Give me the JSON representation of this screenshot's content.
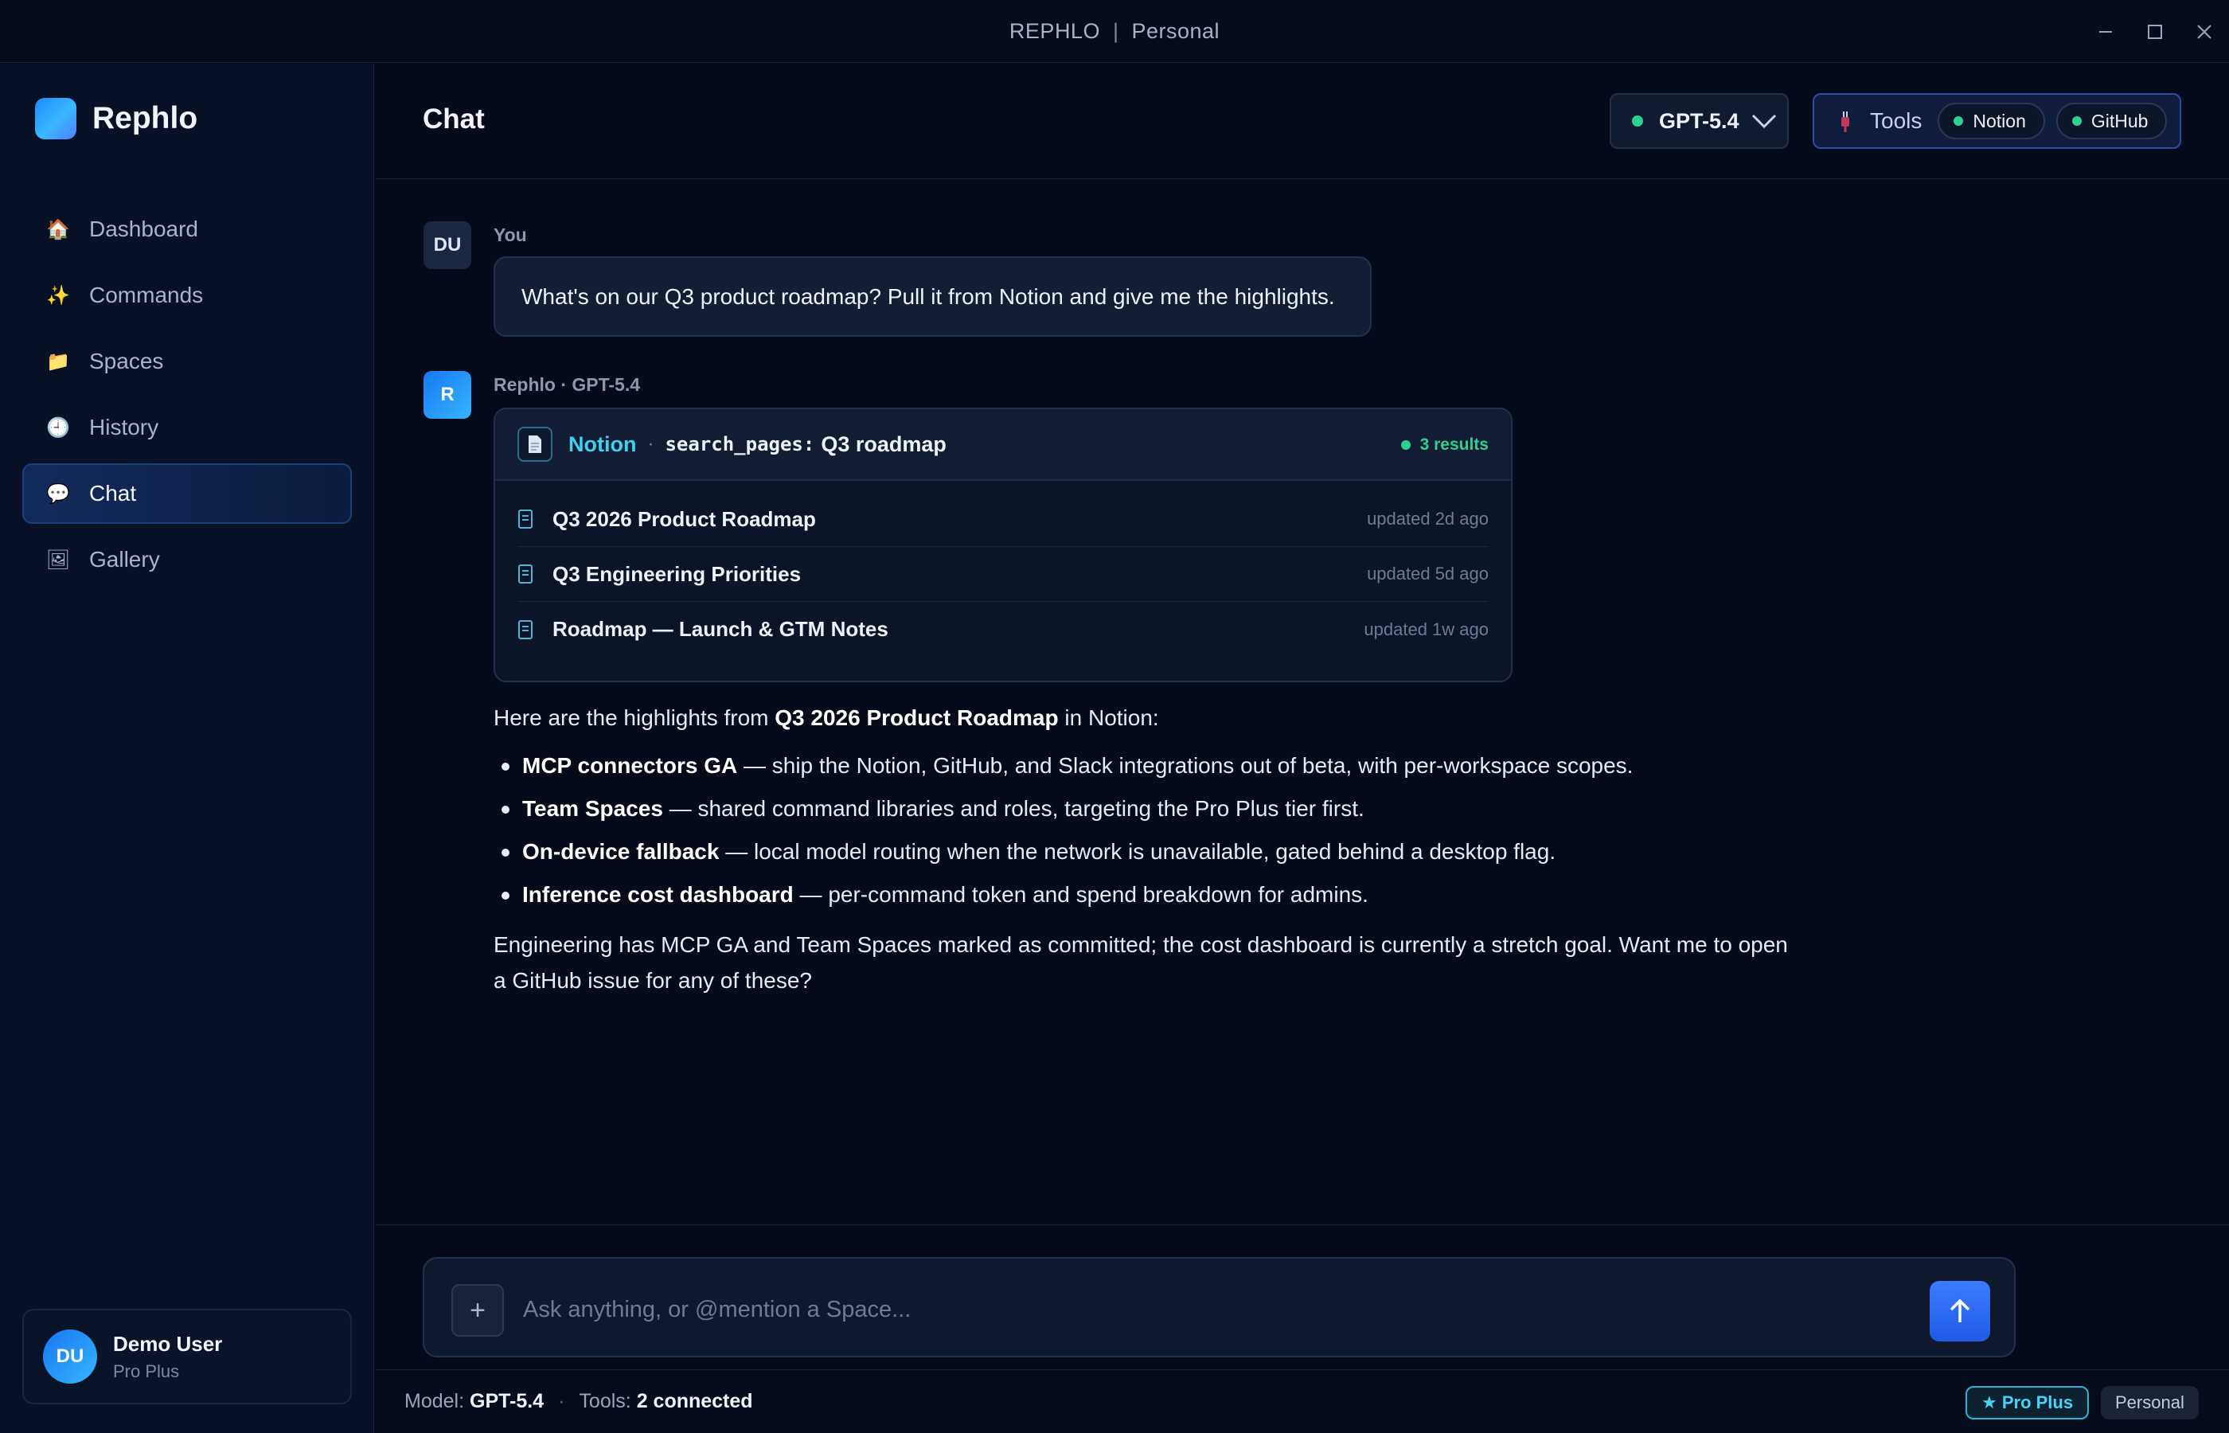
{
  "window": {
    "app_name": "REPHLO",
    "separator": "|",
    "workspace": "Personal"
  },
  "sidebar": {
    "brand": "Rephlo",
    "items": [
      {
        "label": "Dashboard",
        "icon": "house-icon",
        "glyph": "🏠"
      },
      {
        "label": "Commands",
        "icon": "sparkles-icon",
        "glyph": "✨"
      },
      {
        "label": "Spaces",
        "icon": "folder-icon",
        "glyph": "📁"
      },
      {
        "label": "History",
        "icon": "clock-icon",
        "glyph": "🕘"
      },
      {
        "label": "Chat",
        "icon": "speech-bubble-icon",
        "glyph": "💬",
        "active": true
      },
      {
        "label": "Gallery",
        "icon": "picture-icon",
        "glyph": "🖼"
      }
    ],
    "user": {
      "initials": "DU",
      "name": "Demo User",
      "plan": "Pro Plus"
    }
  },
  "header": {
    "title": "Chat",
    "model": "GPT-5.4",
    "tools_label": "Tools",
    "tools": [
      "Notion",
      "GitHub"
    ]
  },
  "conversation": {
    "user_message": {
      "initials": "DU",
      "author": "You",
      "text": "What's on our Q3 product roadmap? Pull it from Notion and give me the highlights."
    },
    "assistant_message": {
      "initials": "R",
      "author": "Rephlo · GPT-5.4",
      "tool_call": {
        "source": "Notion",
        "separator": "·",
        "query_code": "search_pages:",
        "query_text": "Q3 roadmap",
        "results": "3 results",
        "items": [
          {
            "title": "Q3 2026 Product Roadmap",
            "updated": "updated 2d ago"
          },
          {
            "title": "Q3 Engineering Priorities",
            "updated": "updated 5d ago"
          },
          {
            "title": "Roadmap — Launch & GTM Notes",
            "updated": "updated 1w ago"
          }
        ]
      },
      "intro_before": "Here are the highlights from ",
      "intro_bold": "Q3 2026 Product Roadmap",
      "intro_after": " in Notion:",
      "bullets": [
        {
          "bold": "MCP connectors GA",
          "text": " — ship the Notion, GitHub, and Slack integrations out of beta, with per-workspace scopes."
        },
        {
          "bold": "Team Spaces",
          "text": " — shared command libraries and roles, targeting the Pro Plus tier first."
        },
        {
          "bold": "On-device fallback",
          "text": " — local model routing when the network is unavailable, gated behind a desktop flag."
        },
        {
          "bold": "Inference cost dashboard",
          "text": " — per-command token and spend breakdown for admins."
        }
      ],
      "outro": "Engineering has MCP GA and Team Spaces marked as committed; the cost dashboard is currently a stretch goal. Want me to open a GitHub issue for any of these?"
    }
  },
  "composer": {
    "plus": "+",
    "placeholder": "Ask anything, or @mention a Space..."
  },
  "statusbar": {
    "model_label": "Model:",
    "model_value": "GPT-5.4",
    "dot": "·",
    "tools_label": "Tools:",
    "tools_value": "2 connected",
    "plan_badge": "★ Pro Plus",
    "workspace_badge": "Personal"
  },
  "colors": {
    "accent": "#1f5be6",
    "status_green": "#2ed192",
    "notion_cyan": "#3fd0f0",
    "background": "#050b1a"
  }
}
